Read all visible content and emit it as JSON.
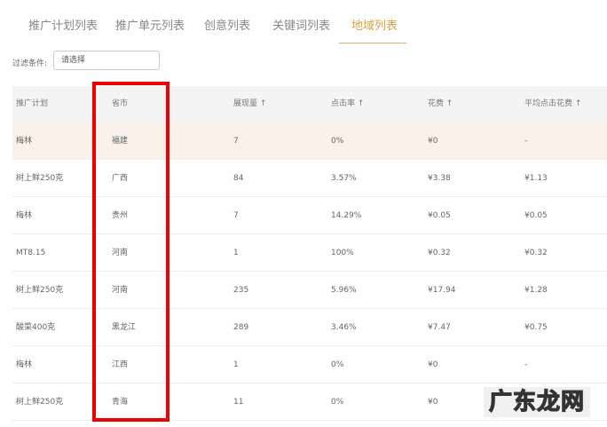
{
  "tabs": [
    {
      "label": "推广计划列表"
    },
    {
      "label": "推广单元列表"
    },
    {
      "label": "创意列表"
    },
    {
      "label": "关键词列表"
    },
    {
      "label": "地域列表",
      "active": true
    }
  ],
  "filter": {
    "label": "过滤条件:",
    "value": "请选择"
  },
  "table": {
    "headers": [
      "推广计划",
      "省市",
      "展现量 ↑",
      "点击率 ↑",
      "花费 ↑",
      "平均点击花费 ↑"
    ],
    "rows": [
      [
        "梅林",
        "福建",
        "7",
        "0%",
        "¥0",
        "-"
      ],
      [
        "树上鲜250克",
        "广西",
        "84",
        "3.57%",
        "¥3.38",
        "¥1.13"
      ],
      [
        "梅林",
        "贵州",
        "7",
        "14.29%",
        "¥0.05",
        "¥0.05"
      ],
      [
        "MT8.15",
        "河南",
        "1",
        "100%",
        "¥0.32",
        "¥0.32"
      ],
      [
        "树上鲜250克",
        "河南",
        "235",
        "5.96%",
        "¥17.94",
        "¥1.28"
      ],
      [
        "酸菜400克",
        "黑龙江",
        "289",
        "3.46%",
        "¥7.47",
        "¥0.75"
      ],
      [
        "梅林",
        "江西",
        "1",
        "0%",
        "¥0",
        "-"
      ],
      [
        "树上鲜250克",
        "青海",
        "11",
        "0%",
        "¥0",
        ""
      ]
    ]
  },
  "watermark": "广东龙网",
  "colors": {
    "accent": "#d9a24a",
    "highlight_row": "#f9f1ea",
    "annotation": "#ee0000"
  }
}
